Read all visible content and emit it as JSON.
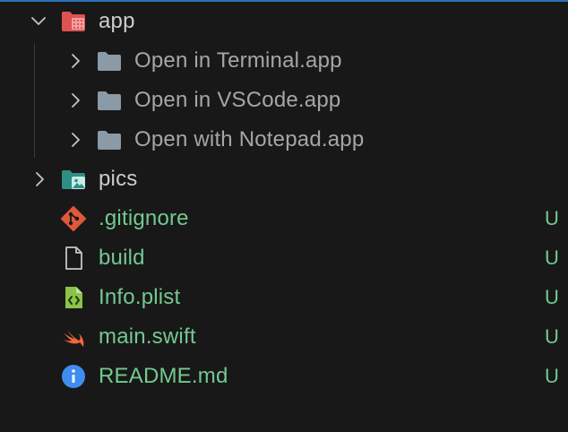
{
  "tree": {
    "app": {
      "label": "app",
      "icon": "red-app-folder-icon"
    },
    "app_children": [
      {
        "label": "Open in Terminal.app",
        "icon": "folder-icon"
      },
      {
        "label": "Open in VSCode.app",
        "icon": "folder-icon"
      },
      {
        "label": "Open with Notepad.app",
        "icon": "folder-icon"
      }
    ],
    "pics": {
      "label": "pics",
      "icon": "teal-image-folder-icon"
    },
    "files": [
      {
        "label": ".gitignore",
        "icon": "git-icon",
        "status": "U"
      },
      {
        "label": "build",
        "icon": "file-icon",
        "status": "U"
      },
      {
        "label": "Info.plist",
        "icon": "plist-file-icon",
        "status": "U"
      },
      {
        "label": "main.swift",
        "icon": "swift-icon",
        "status": "U"
      },
      {
        "label": "README.md",
        "icon": "info-icon",
        "status": "U"
      }
    ]
  },
  "colors": {
    "background": "#181818",
    "untracked": "#73c991",
    "folder_text": "#cccccc",
    "subfolder_text": "#a6a6a6",
    "accent_line": "#2b6fb5"
  }
}
